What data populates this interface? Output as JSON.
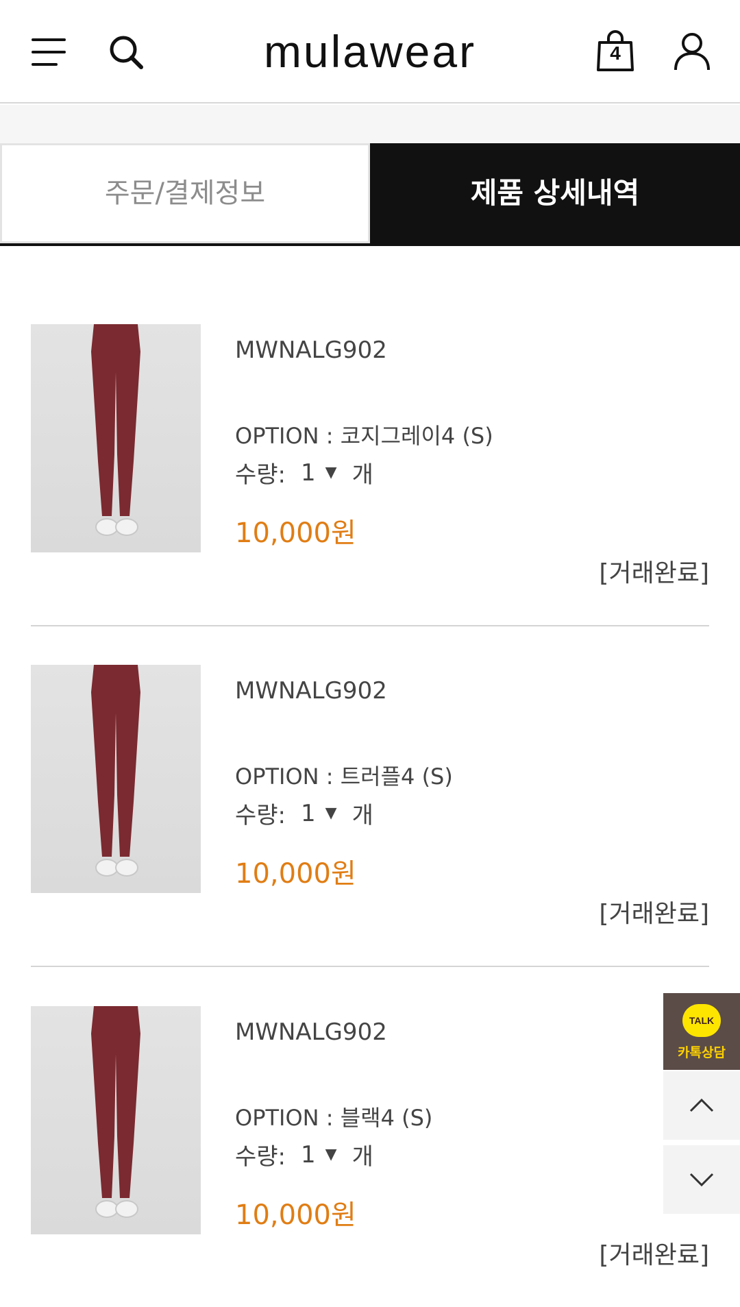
{
  "header": {
    "logo": "mulawear",
    "cart_count": "4",
    "icons": [
      "menu-icon",
      "search-icon",
      "shopping-bag-icon",
      "user-icon"
    ]
  },
  "tabs": [
    {
      "label": "주문/결제정보",
      "active": false
    },
    {
      "label": "제품 상세내역",
      "active": true
    }
  ],
  "items": [
    {
      "code": "MWNALG902",
      "option_label": "OPTION",
      "option_value": "코지그레이4 (S)",
      "qty_label": "수량:",
      "qty": "1",
      "qty_unit": "개",
      "price": "10,000원",
      "status": "[거래완료]"
    },
    {
      "code": "MWNALG902",
      "option_label": "OPTION",
      "option_value": "트러플4 (S)",
      "qty_label": "수량:",
      "qty": "1",
      "qty_unit": "개",
      "price": "10,000원",
      "status": "[거래완료]"
    },
    {
      "code": "MWNALG902",
      "option_label": "OPTION",
      "option_value": "블랙4 (S)",
      "qty_label": "수량:",
      "qty": "1",
      "qty_unit": "개",
      "price": "10,000원",
      "status": "[거래완료]"
    }
  ],
  "side_tools": {
    "kakao_badge": "TALK",
    "kakao_label": "카톡상담"
  },
  "colors": {
    "price": "#e07d14",
    "tab_active_bg": "#111111",
    "kakao_bg": "#5b4c48",
    "kakao_yellow": "#fee500",
    "leggings": "#7a2a30"
  }
}
